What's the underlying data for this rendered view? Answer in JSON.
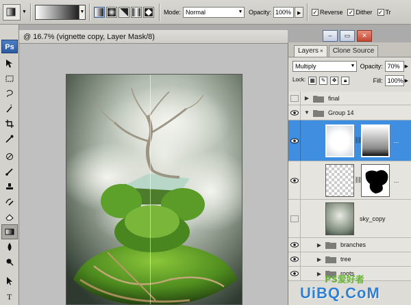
{
  "options_bar": {
    "mode_label": "Mode:",
    "mode_value": "Normal",
    "opacity_label": "Opacity:",
    "opacity_value": "100%",
    "reverse_label": "Reverse",
    "dither_label": "Dither",
    "transparency_label": "Tr",
    "reverse_checked": true,
    "dither_checked": true,
    "transparency_checked": true,
    "gradient_types": [
      "linear-gradient-icon",
      "radial-gradient-icon",
      "angle-gradient-icon",
      "reflected-gradient-icon",
      "diamond-gradient-icon"
    ]
  },
  "toolbox": {
    "logo": "Ps",
    "tools": [
      "move-tool-icon",
      "marquee-tool-icon",
      "lasso-tool-icon",
      "magic-wand-tool-icon",
      "crop-tool-icon",
      "eyedropper-tool-icon",
      "healing-brush-tool-icon",
      "brush-tool-icon",
      "clone-stamp-tool-icon",
      "history-brush-tool-icon",
      "eraser-tool-icon",
      "gradient-tool-icon",
      "blur-tool-icon",
      "dodge-tool-icon",
      "path-selection-tool-icon",
      "type-tool-icon",
      "pen-tool-icon"
    ]
  },
  "document": {
    "title": "@ 16.7% (vignette copy, Layer Mask/8)"
  },
  "window_buttons": {
    "minimize": "–",
    "restore": "▭",
    "close": "✕"
  },
  "layers_panel": {
    "tabs": [
      {
        "label": "Layers",
        "close": "×",
        "active": true
      },
      {
        "label": "Clone Source",
        "close": "",
        "active": false
      }
    ],
    "blend_mode": "Multiply",
    "opacity_label": "Opacity:",
    "opacity_value": "70%",
    "lock_label": "Lock:",
    "fill_label": "Fill:",
    "fill_value": "100%",
    "layers": [
      {
        "name": "final",
        "type": "group",
        "visible": false,
        "expanded": false,
        "indent": 0
      },
      {
        "name": "Group 14",
        "type": "group",
        "visible": true,
        "expanded": true,
        "indent": 0
      },
      {
        "name": "",
        "type": "masked",
        "visible": true,
        "selected": true
      },
      {
        "name": "",
        "type": "masked",
        "visible": true,
        "selected": false
      },
      {
        "name": "sky_copy",
        "type": "image",
        "visible": false
      },
      {
        "name": "branches",
        "type": "group",
        "visible": true,
        "expanded": false,
        "indent": 1
      },
      {
        "name": "tree",
        "type": "group",
        "visible": true,
        "expanded": false,
        "indent": 1
      },
      {
        "name": "roots",
        "type": "group",
        "visible": true,
        "expanded": false,
        "indent": 1
      }
    ]
  },
  "watermark": {
    "line1": "PS爱好者",
    "line2": "UiBQ.CoM"
  },
  "colors": {
    "selection_blue": "#3f8ee0",
    "chrome_grey": "#d3d2cc",
    "canvas_grey": "#c0c0c0"
  }
}
